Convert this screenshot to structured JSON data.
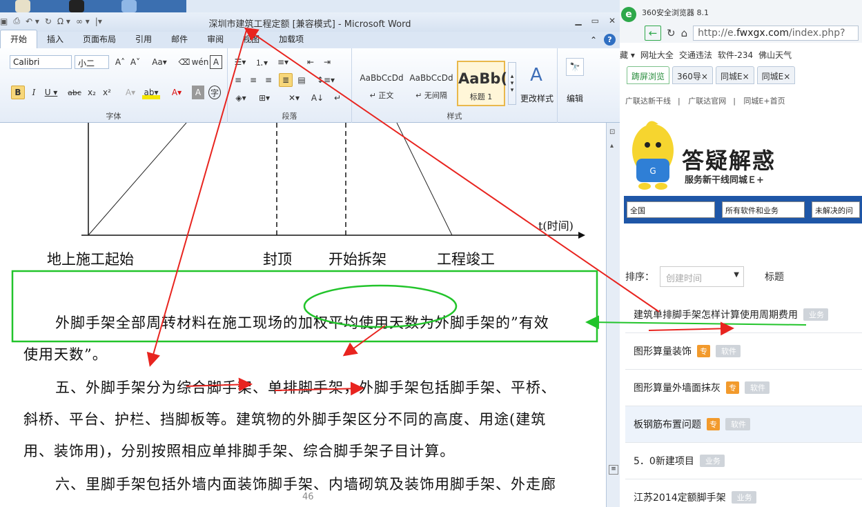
{
  "word": {
    "window_title": "深圳市建筑工程定额 [兼容模式] - Microsoft Word",
    "qat_icons": [
      "save-icon",
      "print-icon",
      "undo-icon",
      "redo-icon",
      "symbol-icon",
      "equation-icon"
    ],
    "tabs": [
      "开始",
      "插入",
      "页面布局",
      "引用",
      "邮件",
      "审阅",
      "视图",
      "加载项"
    ],
    "active_tab": "开始",
    "font_name": "Calibri",
    "font_size": "小二",
    "groups": {
      "font": "字体",
      "paragraph": "段落",
      "styles": "样式"
    },
    "styles": [
      {
        "preview": "AaBbCcDd",
        "name": "↵ 正文"
      },
      {
        "preview": "AaBbCcDd",
        "name": "↵ 无间隔"
      },
      {
        "preview": "AaBb(",
        "name": "标题 1"
      }
    ],
    "change_styles": "更改样式",
    "editing": "编辑",
    "chart_labels": {
      "axis_t": "t(时间)",
      "start": "地上施工起始",
      "cap": "封顶",
      "dismantle": "开始拆架",
      "complete": "工程竣工"
    },
    "paragraphs": {
      "p1_line1": "外脚手架全部周转材料在施工现场的加权平均使用天数为外脚手架的”有效",
      "p1_line2": "使用天数”。",
      "p2_line1": "五、外脚手架分为综合脚手架、单排脚手架，外脚手架包括脚手架、平桥、",
      "p2_line2": "斜桥、平台、护栏、挡脚板等。建筑物的外脚手架区分不同的高度、用途(建筑",
      "p2_line3": "用、装饰用)，分别按照相应单排脚手架、综合脚手架子目计算。",
      "p3_line1": "六、里脚手架包括外墙内面装饰脚手架、内墙砌筑及装饰用脚手架、外走廊"
    },
    "page_number": "46"
  },
  "browser": {
    "name": "360安全浏览器 8.1",
    "url_prefix": "http://e.",
    "url_host": "fwxgx.com",
    "url_path": "/index.php?",
    "bookmarks": [
      "藏 ▾",
      "网址大全",
      "交通违法",
      "软件-234",
      "佛山天气"
    ],
    "tabs": [
      "踌屏浏览",
      "360导×",
      "同城E×",
      "同城E×"
    ],
    "site_nav": [
      "广联达新干线",
      "广联达官网",
      "同城E+首页"
    ],
    "banner_title": "答疑解惑",
    "banner_sub": "服务新干线同城Ｅ+",
    "filters": [
      "全国",
      "所有软件和业务",
      "未解决的问"
    ],
    "sort_label": "排序：",
    "sort_value": "创建时间",
    "column_title": "标题",
    "questions": [
      {
        "title": "建筑单排脚手架怎样计算使用周期费用",
        "special": "",
        "tag": "业务"
      },
      {
        "title": "图形算量装饰",
        "special": "专",
        "tag": "软件"
      },
      {
        "title": "图形算量外墙面抹灰",
        "special": "专",
        "tag": "软件"
      },
      {
        "title": "板钢筋布置问题",
        "special": "专",
        "tag": "软件"
      },
      {
        "title": "5．0新建项目",
        "special": "",
        "tag": "业务"
      },
      {
        "title": "江苏2014定额脚手架",
        "special": "",
        "tag": "业务"
      }
    ]
  },
  "annotation_colors": {
    "arrow": "#e8241f",
    "box": "#22c42b"
  }
}
